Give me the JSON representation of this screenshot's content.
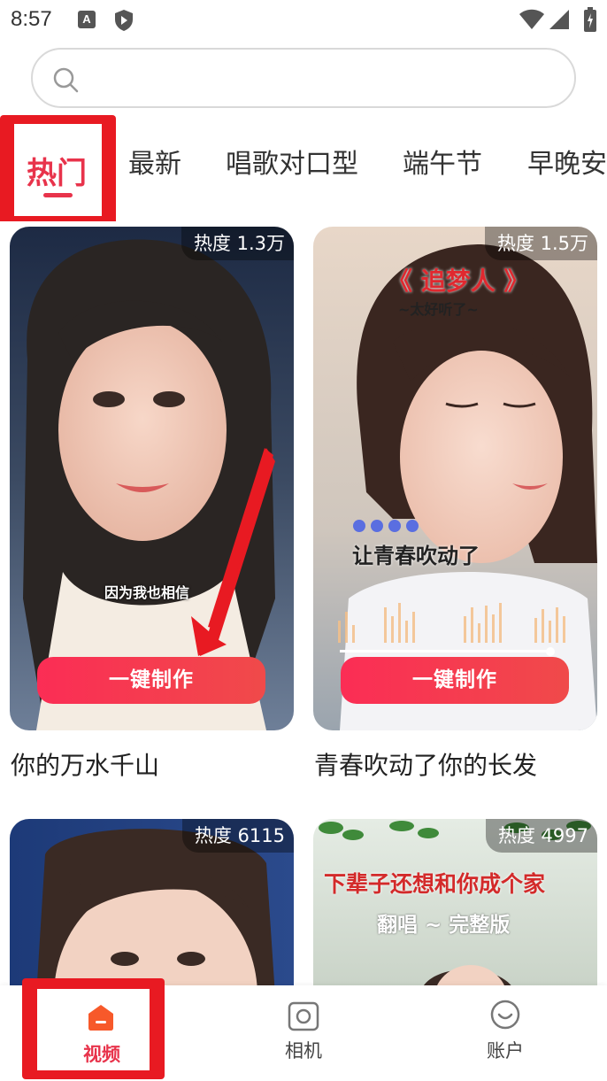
{
  "status_bar": {
    "time": "8:57",
    "a_icon_letter": "A",
    "icons": [
      "a-badge-icon",
      "shield-icon",
      "wifi-icon",
      "signal-icon",
      "battery-icon"
    ]
  },
  "search": {
    "placeholder": "",
    "icon": "search-icon"
  },
  "tabs": [
    {
      "label": "热门",
      "active": true
    },
    {
      "label": "最新"
    },
    {
      "label": "唱歌对口型"
    },
    {
      "label": "端午节"
    },
    {
      "label": "早晚安"
    }
  ],
  "cards": [
    {
      "heat": "热度 1.3万",
      "title": "你的万水千山",
      "button": "一键制作",
      "caption": "因为我也相信"
    },
    {
      "heat": "热度 1.5万",
      "title": "青春吹动了你的长发",
      "button": "一键制作",
      "overlay_title": "《 追梦人 》",
      "overlay_sub": "~太好听了~",
      "caption": "让青春吹动了"
    },
    {
      "heat": "热度 6115",
      "title": ""
    },
    {
      "heat": "热度 4997",
      "title": "",
      "overlay_title": "下辈子还想和你成个家",
      "overlay_sub": "翻唱 ~ 完整版"
    }
  ],
  "bottom_nav": [
    {
      "label": "视频",
      "icon": "home-icon",
      "active": true
    },
    {
      "label": "相机",
      "icon": "camera-icon"
    },
    {
      "label": "账户",
      "icon": "account-icon"
    }
  ],
  "colors": {
    "accent": "#e8334b",
    "highlight_frame": "#e81a22",
    "button_gradient_start": "#fb2d55",
    "button_gradient_end": "#f04a4a",
    "nav_active_icon": "#f7592a"
  }
}
